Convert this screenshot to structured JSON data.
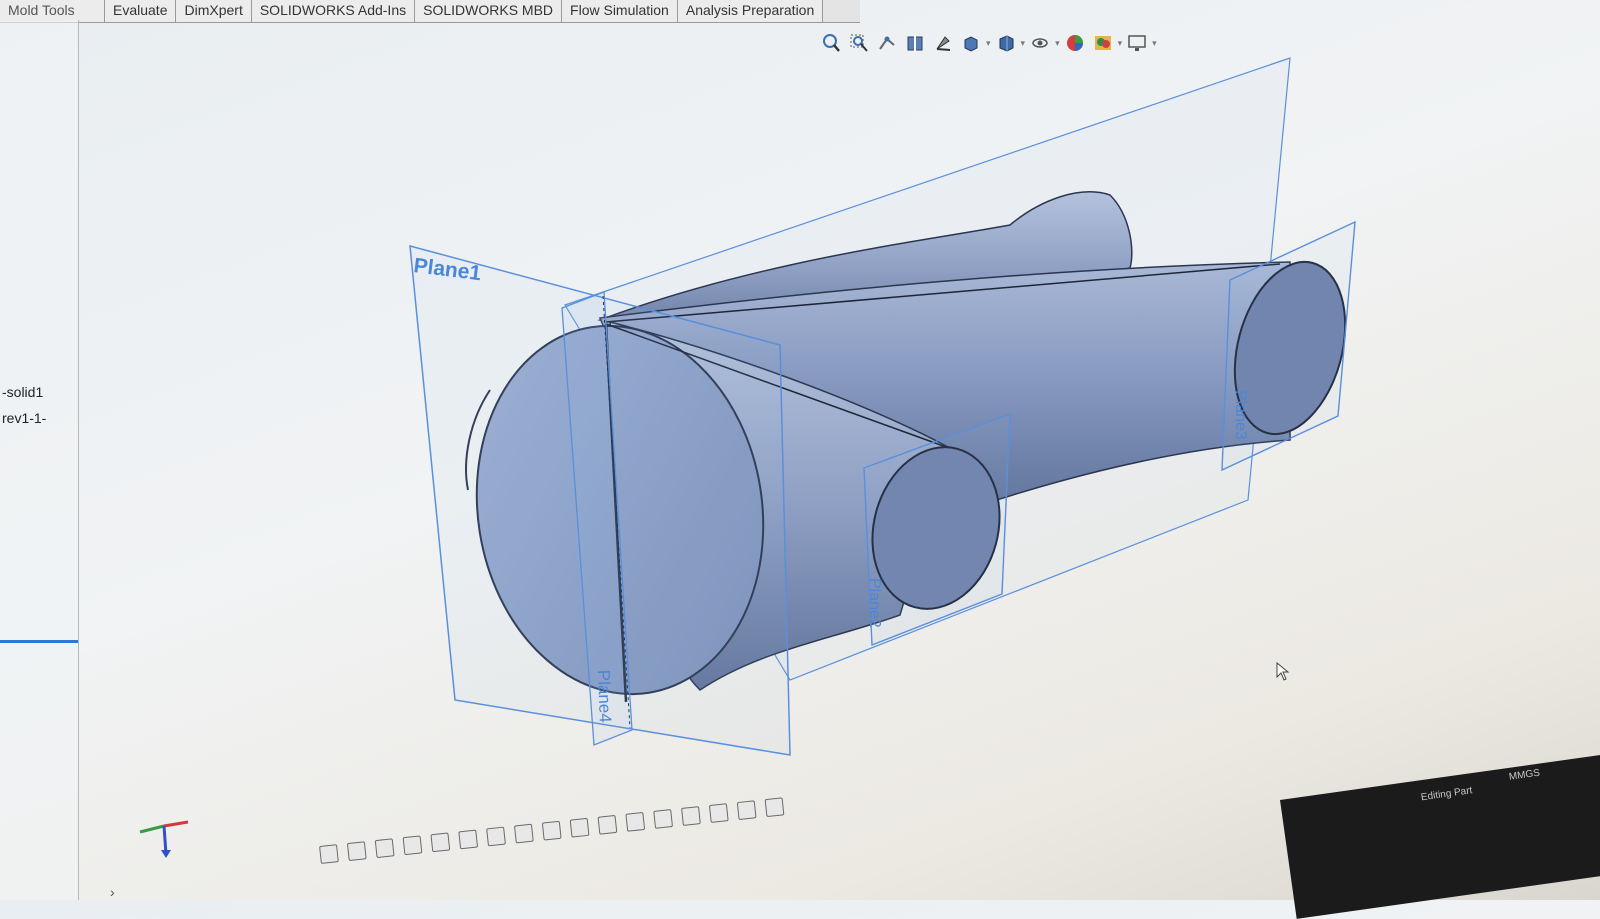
{
  "tabs": [
    {
      "label": "Mold Tools"
    },
    {
      "label": "Evaluate"
    },
    {
      "label": "DimXpert"
    },
    {
      "label": "SOLIDWORKS Add-Ins"
    },
    {
      "label": "SOLIDWORKS MBD"
    },
    {
      "label": "Flow Simulation"
    },
    {
      "label": "Analysis Preparation"
    }
  ],
  "tree": {
    "items": [
      {
        "label": "-solid1"
      },
      {
        "label": "rev1-1-"
      }
    ]
  },
  "viewport": {
    "planes": [
      {
        "label": "Plane1"
      },
      {
        "label": "Plane2"
      },
      {
        "label": "Plane3"
      },
      {
        "label": "Plane4"
      }
    ]
  },
  "heads_up_toolbar": {
    "icons": [
      "zoom-to-fit-icon",
      "zoom-area-icon",
      "previous-view-icon",
      "section-view-icon",
      "dynamic-annotation-icon",
      "view-orientation-icon",
      "display-style-icon",
      "hide-show-icon",
      "edit-appearance-icon",
      "apply-scene-icon",
      "view-settings-icon"
    ]
  },
  "status": {
    "mode": "Editing Part",
    "units": "MMGS"
  },
  "colors": {
    "model": "#7d8fb3",
    "plane_edge": "#5a8fdc",
    "background": "#eef1f3"
  }
}
